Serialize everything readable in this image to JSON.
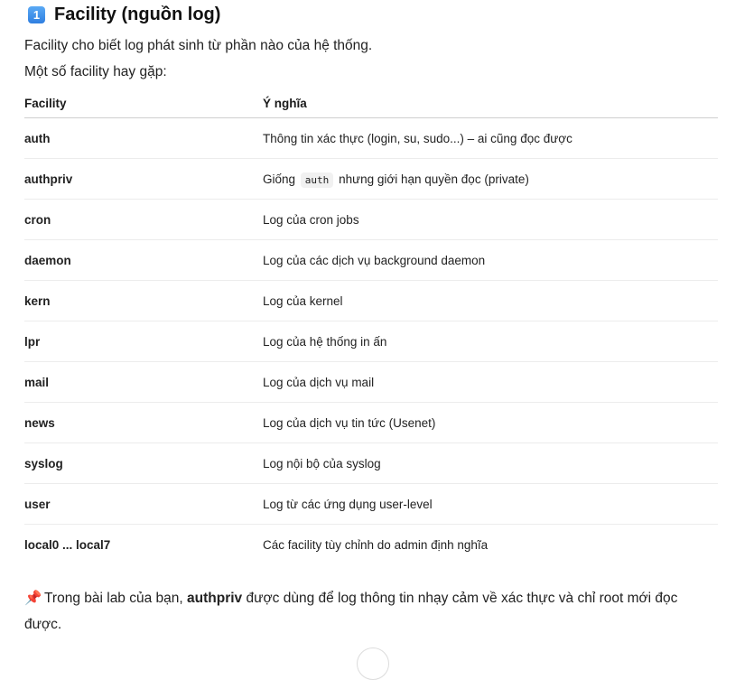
{
  "heading": {
    "badge": "1",
    "title": "Facility (nguồn log)"
  },
  "intro": {
    "line1": "Facility cho biết log phát sinh từ phần nào của hệ thống.",
    "line2": "Một số facility hay gặp:"
  },
  "table": {
    "headers": [
      "Facility",
      "Ý nghĩa"
    ],
    "rows": [
      {
        "facility": "auth",
        "meaning": "Thông tin xác thực (login, su, sudo...) – ai cũng đọc được"
      },
      {
        "facility": "authpriv",
        "meaning_before": "Giống",
        "meaning_code": "auth",
        "meaning_after": "nhưng giới hạn quyền đọc (private)"
      },
      {
        "facility": "cron",
        "meaning": "Log của cron jobs"
      },
      {
        "facility": "daemon",
        "meaning": "Log của các dịch vụ background daemon"
      },
      {
        "facility": "kern",
        "meaning": "Log của kernel"
      },
      {
        "facility": "lpr",
        "meaning": "Log của hệ thống in ấn"
      },
      {
        "facility": "mail",
        "meaning": "Log của dịch vụ mail"
      },
      {
        "facility": "news",
        "meaning": "Log của dịch vụ tin tức (Usenet)"
      },
      {
        "facility": "syslog",
        "meaning": "Log nội bộ của syslog"
      },
      {
        "facility": "user",
        "meaning": "Log từ các ứng dụng user-level"
      },
      {
        "facility": "local0 ... local7",
        "meaning": "Các facility tùy chỉnh do admin định nghĩa"
      }
    ]
  },
  "note": {
    "icon": "pushpin-icon",
    "prefix": "Trong bài lab của bạn,",
    "bold": "authpriv",
    "suffix": "được dùng để log thông tin nhạy cảm về xác thực và chỉ root mới đọc được."
  },
  "colors": {
    "badge": "#3b8beb",
    "pin": "#d83a3a"
  }
}
